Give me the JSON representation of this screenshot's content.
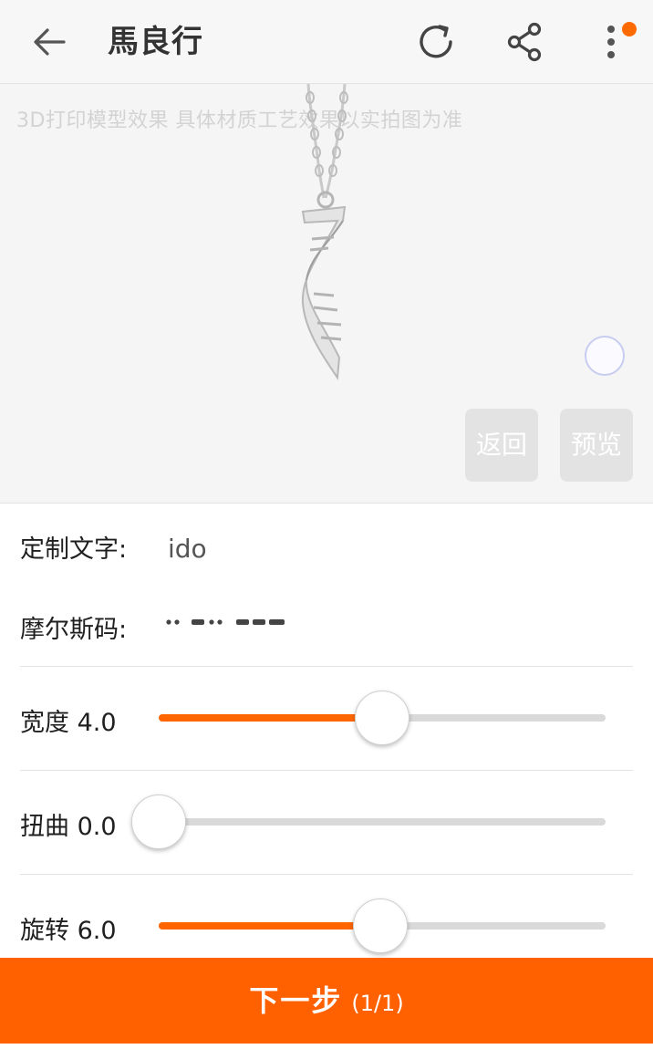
{
  "header": {
    "title": "馬良行",
    "icons": {
      "back": "arrow-left-icon",
      "refresh": "refresh-icon",
      "share": "share-icon",
      "more": "more-vertical-icon"
    },
    "badge_color": "#ff6a00"
  },
  "preview": {
    "watermark": "3D打印模型效果 具体材质工艺效果以实拍图为准",
    "return_label": "返回",
    "preview_label": "预览"
  },
  "form": {
    "custom_text_label": "定制文字:",
    "custom_text_value": "ido",
    "morse_label": "摩尔斯码:",
    "sliders": [
      {
        "label": "宽度",
        "value": "4.0",
        "fraction": 0.5
      },
      {
        "label": "扭曲",
        "value": "0.0",
        "fraction": 0.0
      },
      {
        "label": "旋转",
        "value": "6.0",
        "fraction": 0.495
      }
    ]
  },
  "footer": {
    "next_label": "下一步",
    "count": "(1/1)"
  },
  "colors": {
    "accent": "#ff6100",
    "track": "#d9d9d9"
  }
}
